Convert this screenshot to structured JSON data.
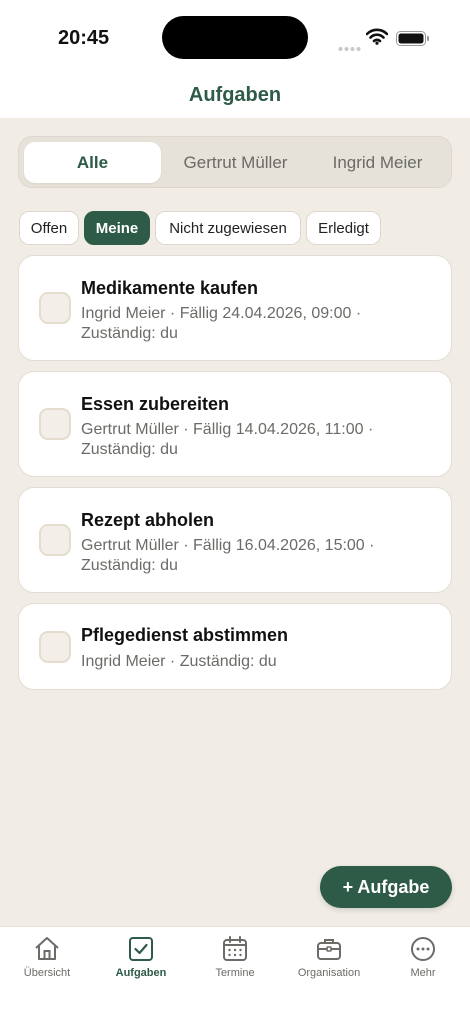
{
  "status_bar": {
    "time": "20:45"
  },
  "header": {
    "title": "Aufgaben"
  },
  "segments": [
    {
      "label": "Alle",
      "active": true
    },
    {
      "label": "Gertrut Müller",
      "active": false
    },
    {
      "label": "Ingrid Meier",
      "active": false
    }
  ],
  "filters": [
    {
      "label": "Offen",
      "active": false
    },
    {
      "label": "Meine",
      "active": true
    },
    {
      "label": "Nicht zugewiesen",
      "active": false
    },
    {
      "label": "Erledigt",
      "active": false
    }
  ],
  "tasks": [
    {
      "title": "Medikamente kaufen",
      "meta_line1": "Ingrid Meier · Fällig 24.04.2026, 09:00 ·",
      "meta_line2": "Zuständig: du",
      "done": false
    },
    {
      "title": "Essen zubereiten",
      "meta_line1": "Gertrut Müller · Fällig 14.04.2026, 11:00 ·",
      "meta_line2": "Zuständig: du",
      "done": false
    },
    {
      "title": "Rezept abholen",
      "meta_line1": "Gertrut Müller · Fällig 16.04.2026, 15:00 ·",
      "meta_line2": "Zuständig: du",
      "done": false
    },
    {
      "title": "Pflegedienst abstimmen",
      "meta_line1": "Ingrid Meier · Zuständig: du",
      "meta_line2": "",
      "done": false
    }
  ],
  "fab": {
    "label": "+ Aufgabe"
  },
  "tabbar": [
    {
      "label": "Übersicht",
      "icon": "home-icon",
      "active": false
    },
    {
      "label": "Aufgaben",
      "icon": "checkbox-icon",
      "active": true
    },
    {
      "label": "Termine",
      "icon": "calendar-icon",
      "active": false
    },
    {
      "label": "Organisation",
      "icon": "briefcase-icon",
      "active": false
    },
    {
      "label": "Mehr",
      "icon": "more-icon",
      "active": false
    }
  ],
  "colors": {
    "accent": "#2e5a48",
    "background": "#f1ede6",
    "card": "#ffffff"
  }
}
